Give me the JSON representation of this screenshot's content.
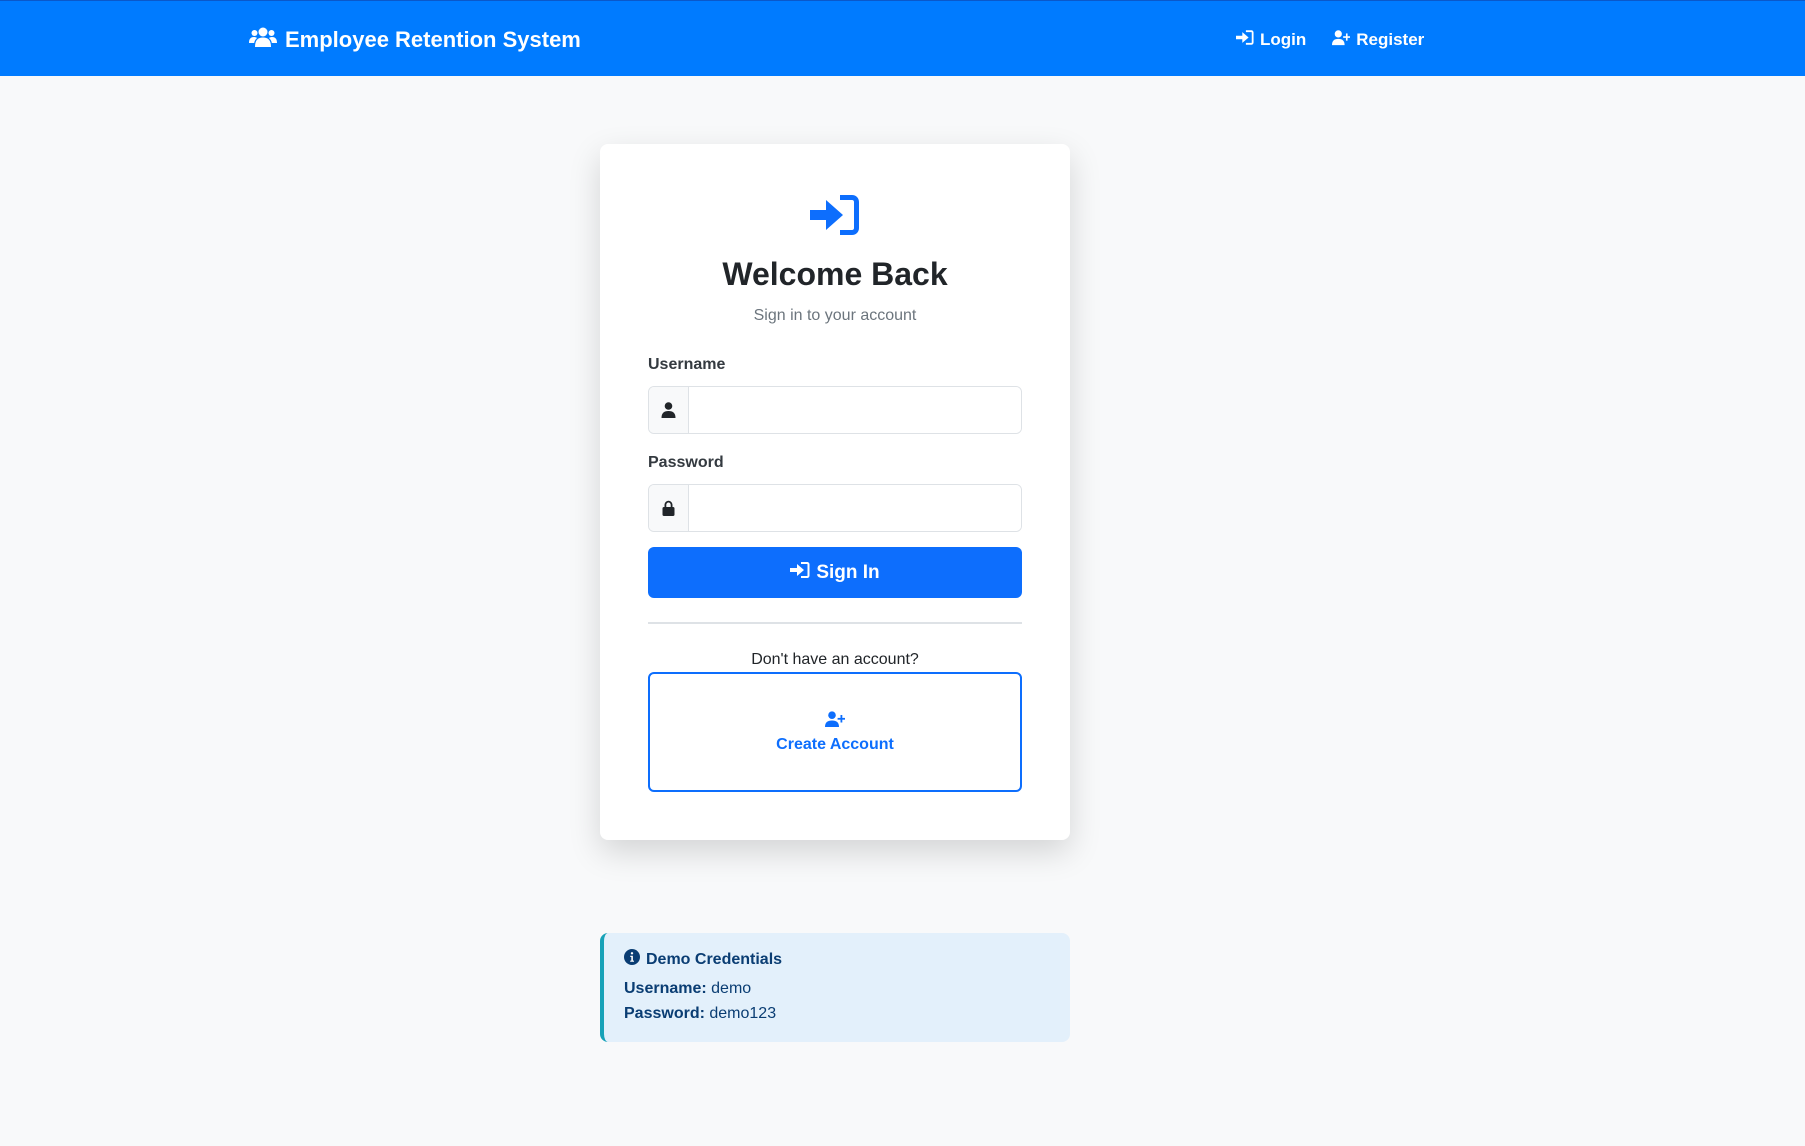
{
  "navbar": {
    "brand": "Employee Retention System",
    "links": [
      {
        "label": "Login",
        "icon": "sign-in-icon"
      },
      {
        "label": "Register",
        "icon": "user-plus-icon"
      }
    ]
  },
  "login": {
    "icon": "sign-in-icon",
    "title": "Welcome Back",
    "subtitle": "Sign in to your account",
    "username_label": "Username",
    "username_value": "",
    "password_label": "Password",
    "password_value": "",
    "submit_label": "Sign In",
    "no_account_text": "Don't have an account?",
    "create_account_label": "Create Account"
  },
  "demo": {
    "title": "Demo Credentials",
    "username_label": "Username:",
    "username_value": "demo",
    "password_label": "Password:",
    "password_value": "demo123"
  },
  "colors": {
    "primary": "#0d6efd",
    "navbar": "#007bff",
    "info_border": "#17a2b8",
    "info_bg": "#e3f0fb",
    "background": "#f8f9fa"
  }
}
